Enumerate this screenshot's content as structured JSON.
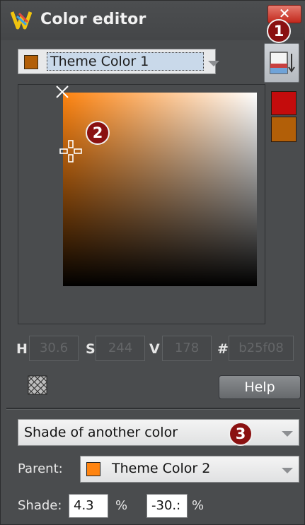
{
  "window": {
    "title": "Color editor",
    "close_glyph": "✕"
  },
  "color_select": {
    "swatch_color": "#b25f08",
    "selected": "Theme Color 1"
  },
  "badges": [
    "1",
    "2",
    "3"
  ],
  "swatches": {
    "new_color": "#c40c0c",
    "old_color": "#b25f08"
  },
  "hsv": {
    "h_label": "H",
    "h_value": "30.6",
    "s_label": "S",
    "s_value": "244",
    "v_label": "V",
    "v_value": "178",
    "hex_label": "#",
    "hex_value": "b25f08"
  },
  "buttons": {
    "help": "Help"
  },
  "mode": {
    "selected": "Shade of another color"
  },
  "parent": {
    "label": "Parent:",
    "swatch_color": "#ff8410",
    "selected": "Theme Color 2"
  },
  "shade": {
    "label": "Shade:",
    "value1": "4.3",
    "unit1": "%",
    "value2": "-30.:",
    "unit2": "%"
  },
  "icons": {
    "app_logo": "xara-logo-icon",
    "side_panel": "side-panel-toggle-icon",
    "transparency": "checker-transparency-icon",
    "crosshair": "crosshair-icon",
    "original_marker": "x-marker-icon"
  }
}
